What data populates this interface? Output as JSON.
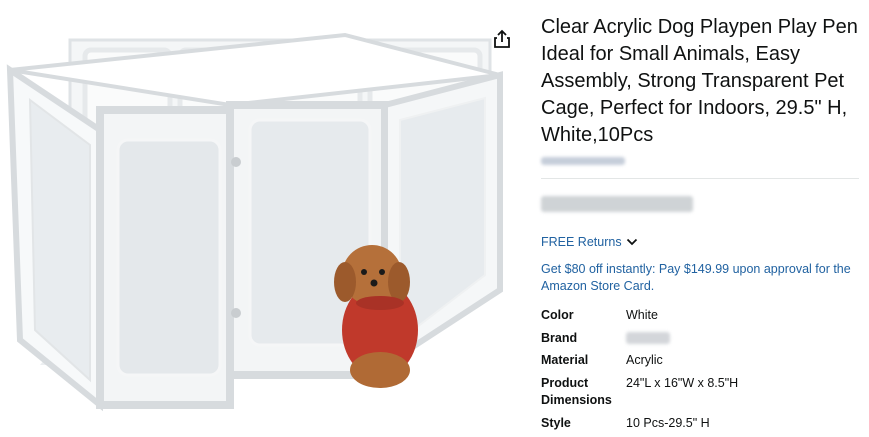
{
  "product": {
    "title": "Clear Acrylic Dog Playpen Play Pen Ideal for Small Animals, Easy Assembly, Strong Transparent Pet Cage, Perfect for Indoors, 29.5\" H, White,10Pcs",
    "share_icon": "share-icon",
    "image_alt": "white acrylic dog playpen with small poodle in red sweater"
  },
  "delivery": {
    "returns_label": "FREE Returns",
    "returns_icon": "chevron-down-icon"
  },
  "promo": {
    "text": "Get $80 off instantly: Pay $149.99 upon approval for the Amazon Store Card."
  },
  "specs": [
    {
      "key": "Color",
      "value": "White"
    },
    {
      "key": "Brand",
      "value": ""
    },
    {
      "key": "Material",
      "value": "Acrylic"
    },
    {
      "key": "Product Dimensions",
      "value": "24\"L x 16\"W x 8.5\"H"
    },
    {
      "key": "Style",
      "value": "10 Pcs-29.5\" H"
    }
  ],
  "colors": {
    "link": "#2162a1",
    "text": "#0f1111",
    "divider": "#e3e6e6"
  }
}
